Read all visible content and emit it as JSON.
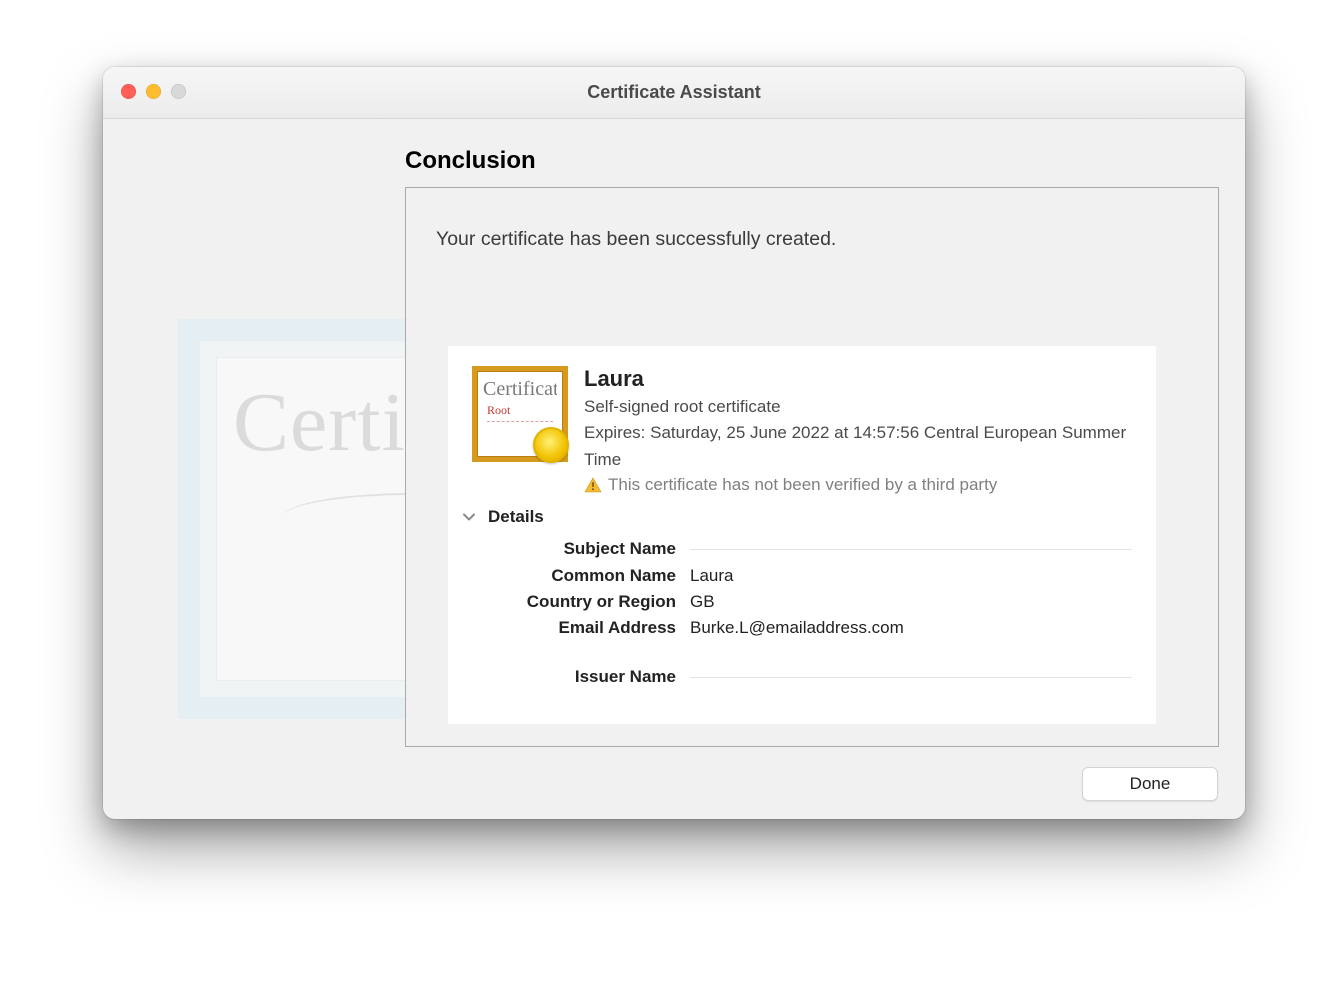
{
  "window": {
    "title": "Certificate Assistant",
    "heading": "Conclusion",
    "summary": "Your certificate has been successfully created.",
    "done_label": "Done"
  },
  "watermark": {
    "script_text": "Certific"
  },
  "certificate": {
    "name": "Laura",
    "type": "Self-signed root certificate",
    "expires_label": "Expires: Saturday, 25 June 2022 at 14:57:56 Central European Summer Time",
    "warning_text": "This certificate has not been verified by a third party",
    "thumb": {
      "script": "Certificate",
      "root": "Root"
    }
  },
  "details": {
    "label": "Details",
    "subject_name_label": "Subject Name",
    "issuer_name_label": "Issuer Name",
    "fields": {
      "common_name": {
        "label": "Common Name",
        "value": "Laura"
      },
      "country": {
        "label": "Country or Region",
        "value": "GB"
      },
      "email": {
        "label": "Email Address",
        "value": "Burke.L@emailaddress.com"
      }
    }
  }
}
